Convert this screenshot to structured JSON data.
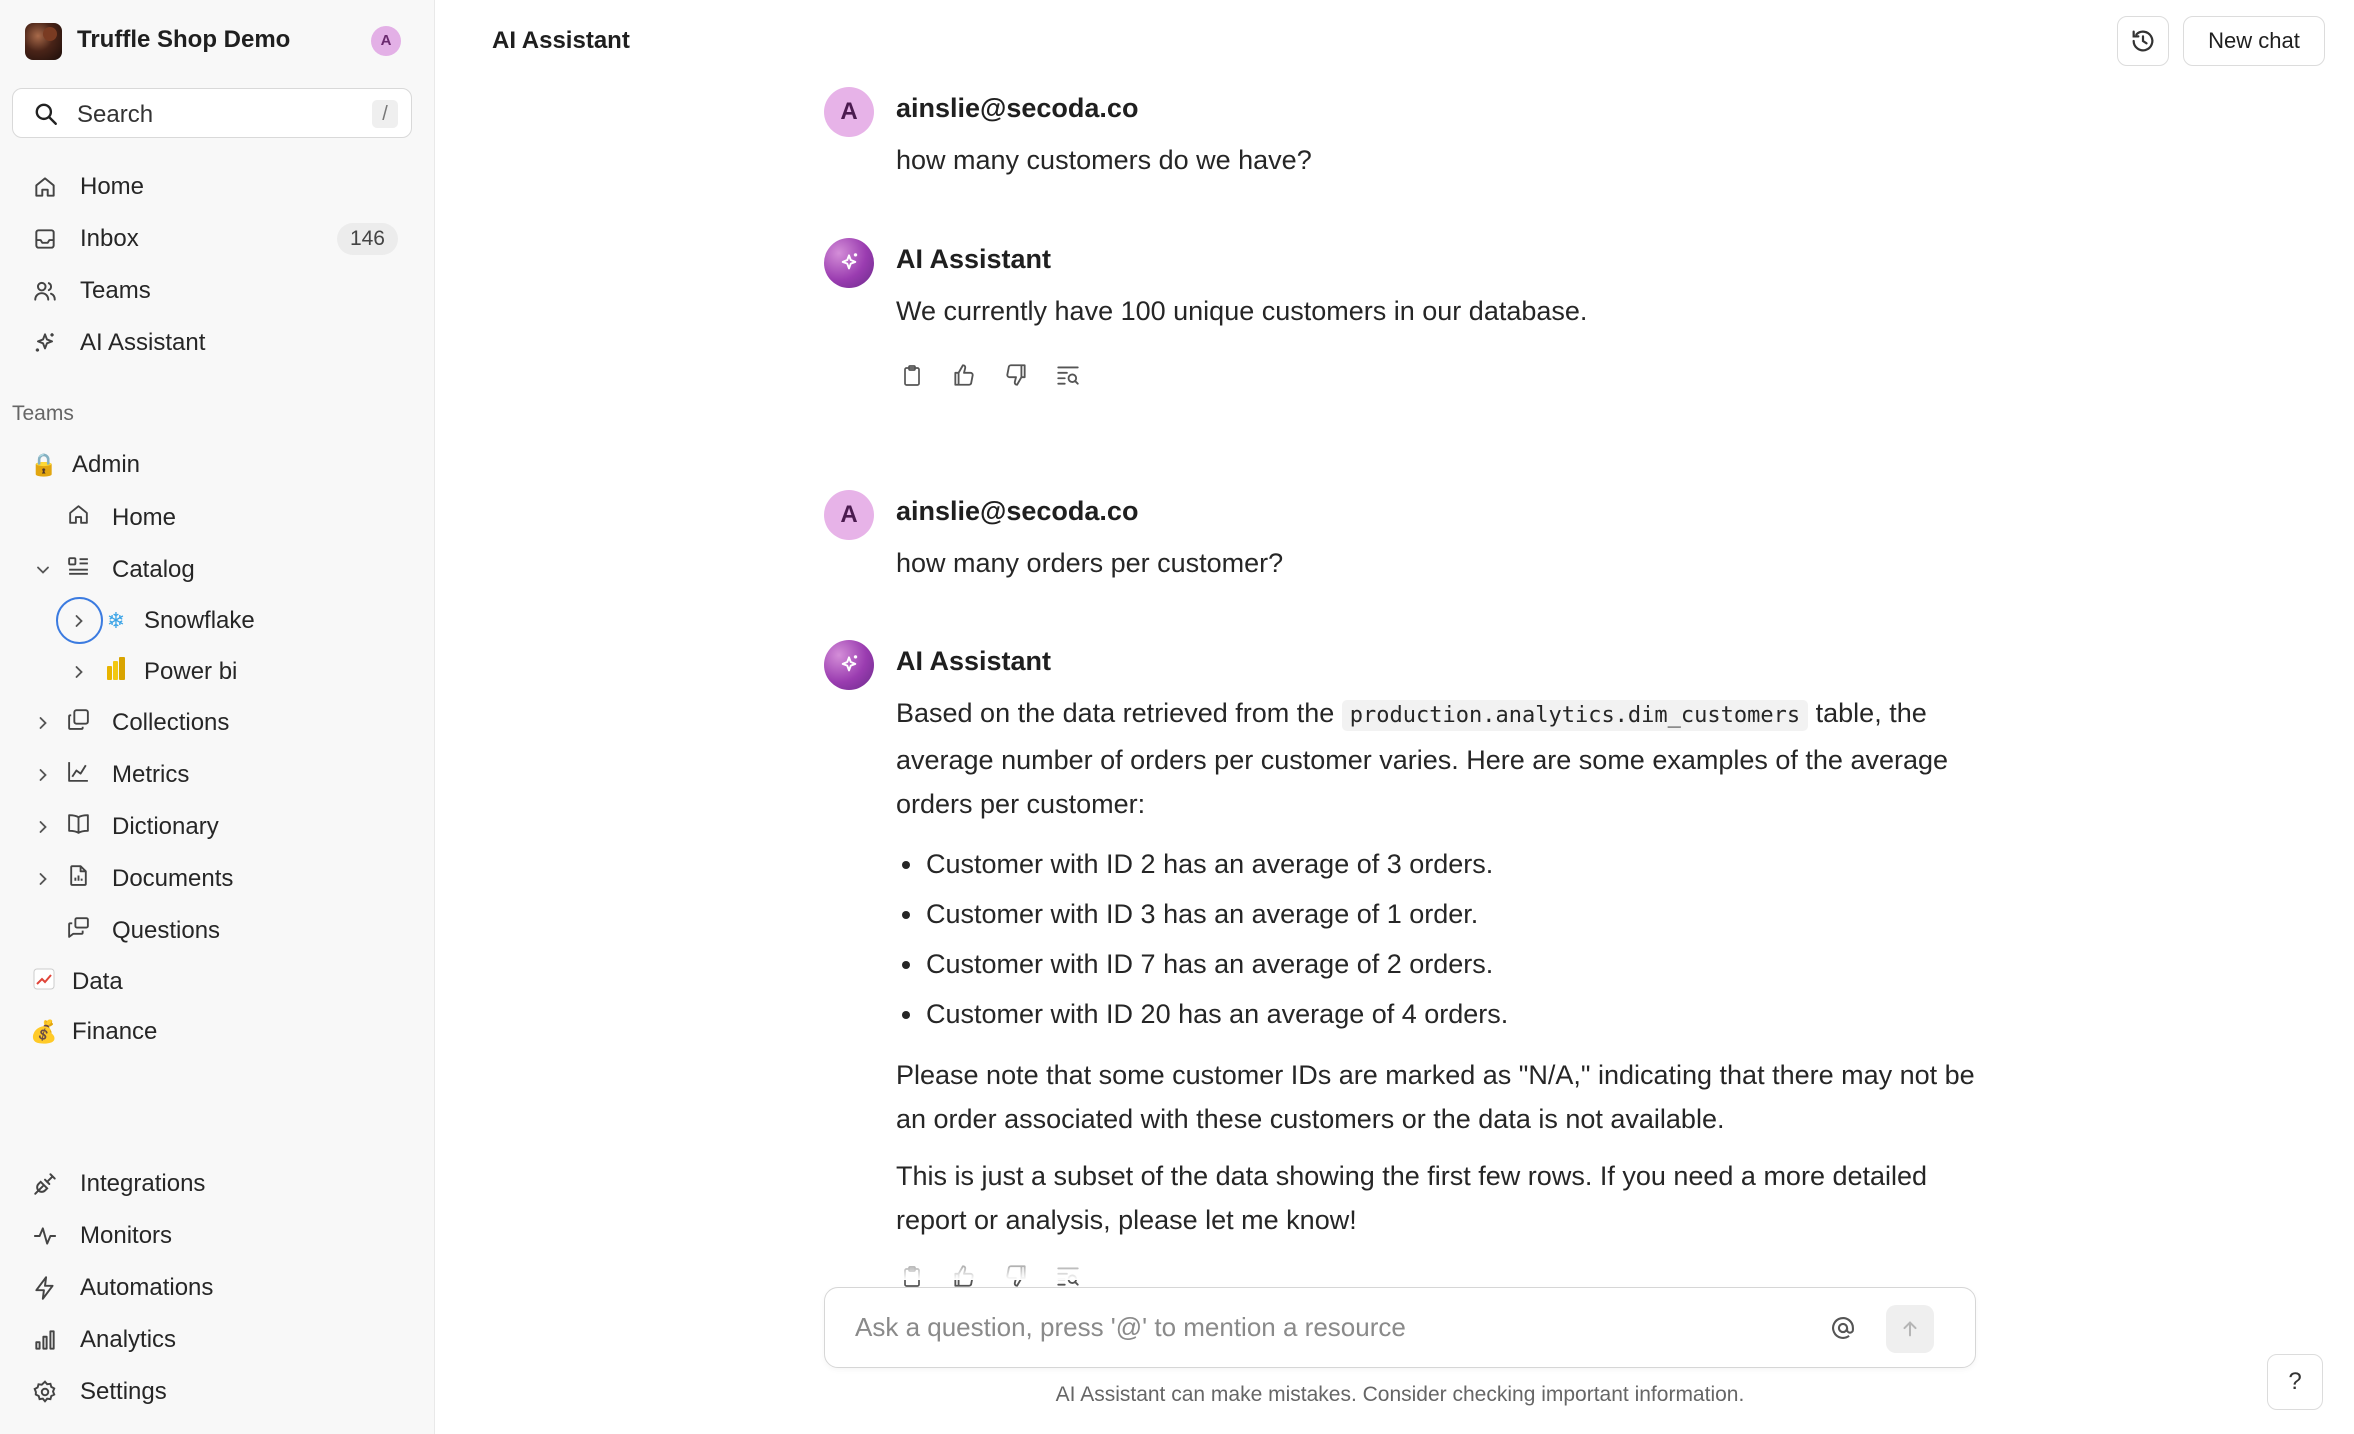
{
  "workspace": {
    "name": "Truffle Shop Demo",
    "avatar_initial": "A"
  },
  "search": {
    "label": "Search",
    "shortcut": "/"
  },
  "nav": {
    "home": "Home",
    "inbox": "Inbox",
    "inbox_count": "146",
    "teams": "Teams",
    "ai_assistant": "AI Assistant"
  },
  "teams_section": {
    "title": "Teams",
    "admin": "Admin",
    "admin_home": "Home",
    "catalog": "Catalog",
    "snowflake": "Snowflake",
    "power_bi": "Power bi",
    "collections": "Collections",
    "metrics": "Metrics",
    "dictionary": "Dictionary",
    "documents": "Documents",
    "questions": "Questions",
    "data": "Data",
    "finance": "Finance"
  },
  "bottom_nav": {
    "integrations": "Integrations",
    "monitors": "Monitors",
    "automations": "Automations",
    "analytics": "Analytics",
    "settings": "Settings"
  },
  "header": {
    "title": "AI Assistant",
    "new_chat": "New chat"
  },
  "messages": [
    {
      "author": "ainslie@secoda.co",
      "avatar": "A",
      "text": "how many customers do we have?"
    },
    {
      "author": "AI Assistant",
      "text": "We currently have 100 unique customers in our database."
    },
    {
      "author": "ainslie@secoda.co",
      "avatar": "A",
      "text": "how many orders per customer?"
    },
    {
      "author": "AI Assistant",
      "intro_before": "Based on the data retrieved from the",
      "table_name": "production.analytics.dim_customers",
      "intro_after": "table, the average number of orders per customer varies. Here are some examples of the average orders per customer:",
      "bullets": [
        "Customer with ID 2 has an average of 3 orders.",
        "Customer with ID 3 has an average of 1 order.",
        "Customer with ID 7 has an average of 2 orders.",
        "Customer with ID 20 has an average of 4 orders."
      ],
      "note": "Please note that some customer IDs are marked as \"N/A,\" indicating that there may not be an order associated with these customers or the data is not available.",
      "closing": "This is just a subset of the data showing the first few rows. If you need a more detailed report or analysis, please let me know!"
    }
  ],
  "composer": {
    "placeholder": "Ask a question, press '@' to mention a resource"
  },
  "disclaimer": "AI Assistant can make mistakes. Consider checking important information.",
  "help_label": "?"
}
